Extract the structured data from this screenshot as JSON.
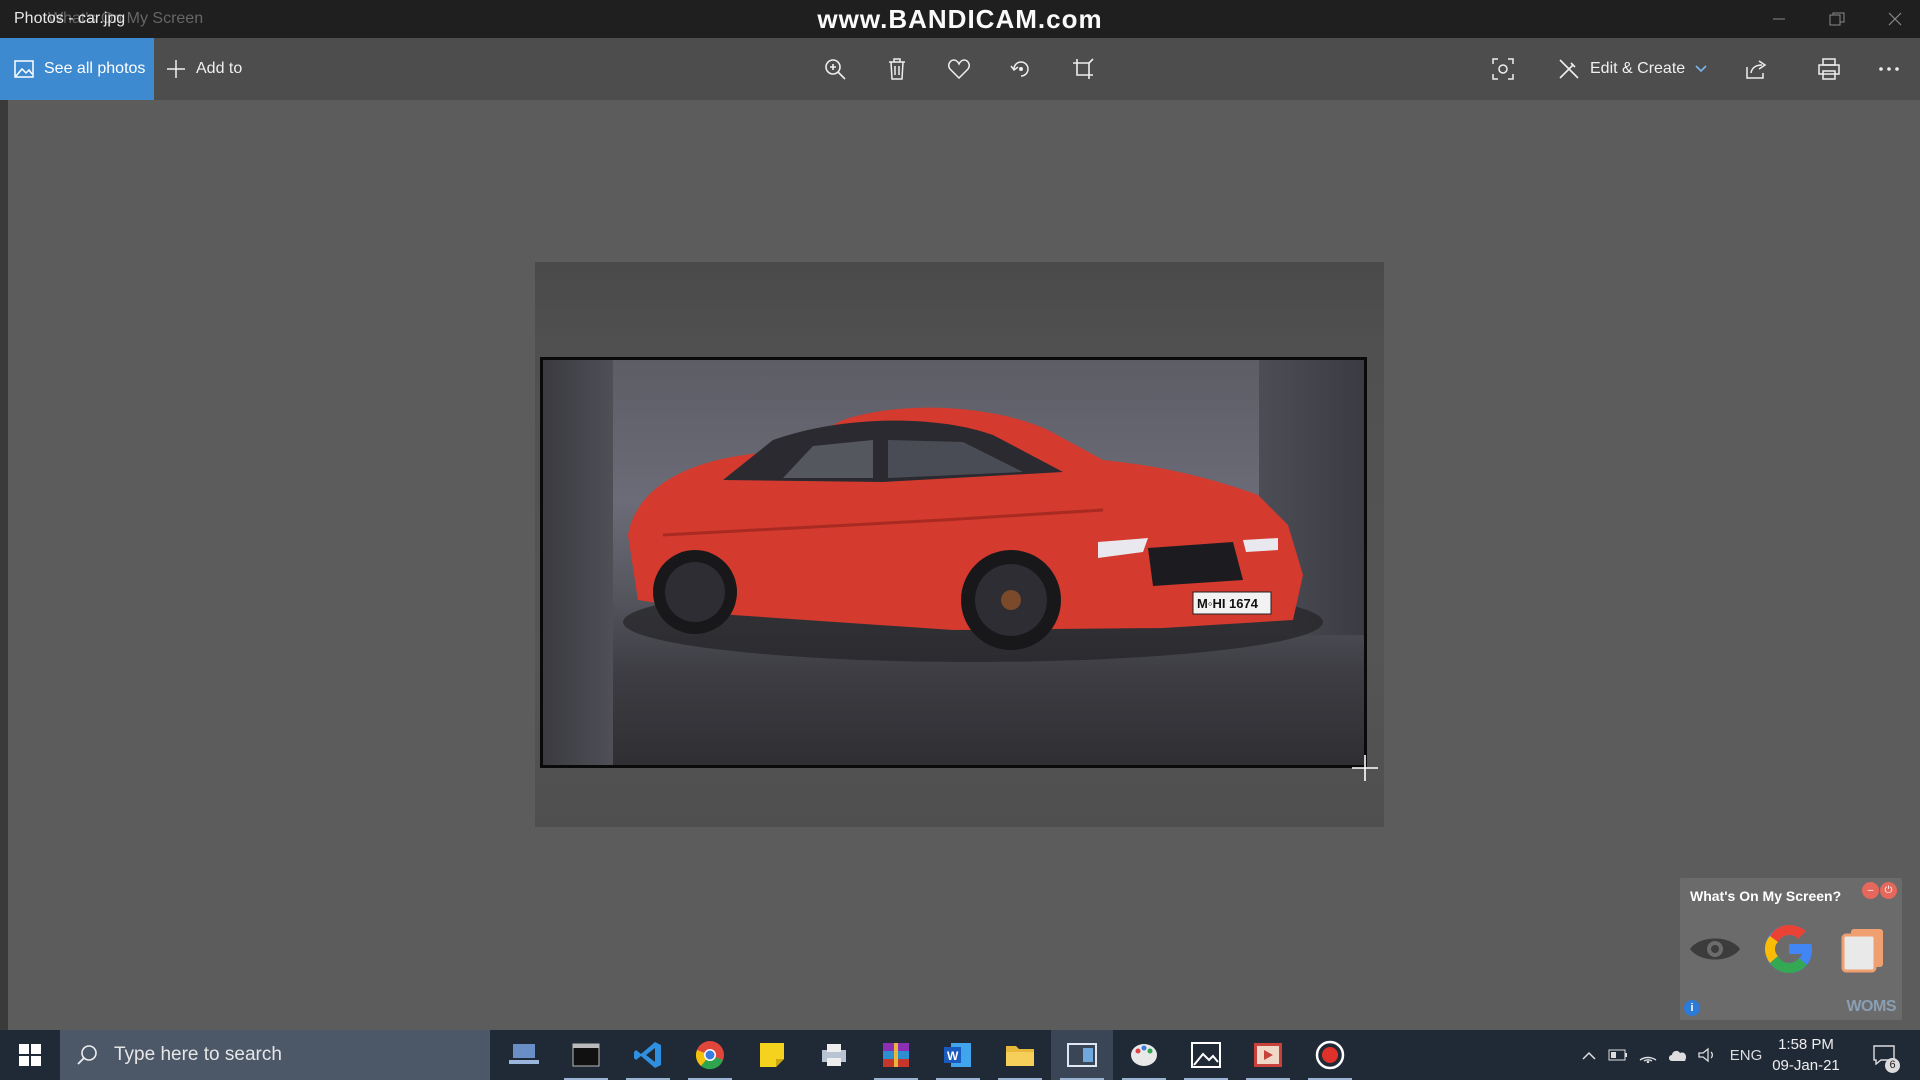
{
  "titlebar": {
    "title": "Photos - car.jpg",
    "ghost_text": "What's On My Screen",
    "watermark": "www.BANDICAM.com"
  },
  "toolbar": {
    "see_all_label": "See all photos",
    "add_to_label": "Add to",
    "edit_create_label": "Edit & Create",
    "tools": [
      "zoom-icon",
      "delete-icon",
      "favorite-icon",
      "rotate-icon",
      "crop-icon",
      "enhance-icon",
      "share-icon",
      "print-icon",
      "more-icon"
    ]
  },
  "image": {
    "file": "car.jpg",
    "plate": "M◦HI 1674",
    "car_color": "#e53a2c"
  },
  "woms": {
    "title": "What's On My Screen?",
    "brand": "WOMS",
    "info": "i"
  },
  "taskbar": {
    "search_placeholder": "Type here to search",
    "apps": [
      "network-app-icon",
      "terminal-icon",
      "vscode-icon",
      "chrome-icon",
      "sticky-notes-icon",
      "printer-app-icon",
      "winrar-icon",
      "word-icon",
      "file-explorer-icon",
      "snip-icon",
      "paint-icon",
      "photos-icon",
      "video-editor-icon",
      "bandicam-record-icon"
    ],
    "language": "ENG",
    "time": "1:58 PM",
    "date": "09-Jan-21",
    "notification_count": "6"
  },
  "colors": {
    "accent": "#3e8ad0",
    "titlebar": "#1f1f1f",
    "toolbar": "#4d4d4d",
    "taskbar": "#202a37"
  }
}
